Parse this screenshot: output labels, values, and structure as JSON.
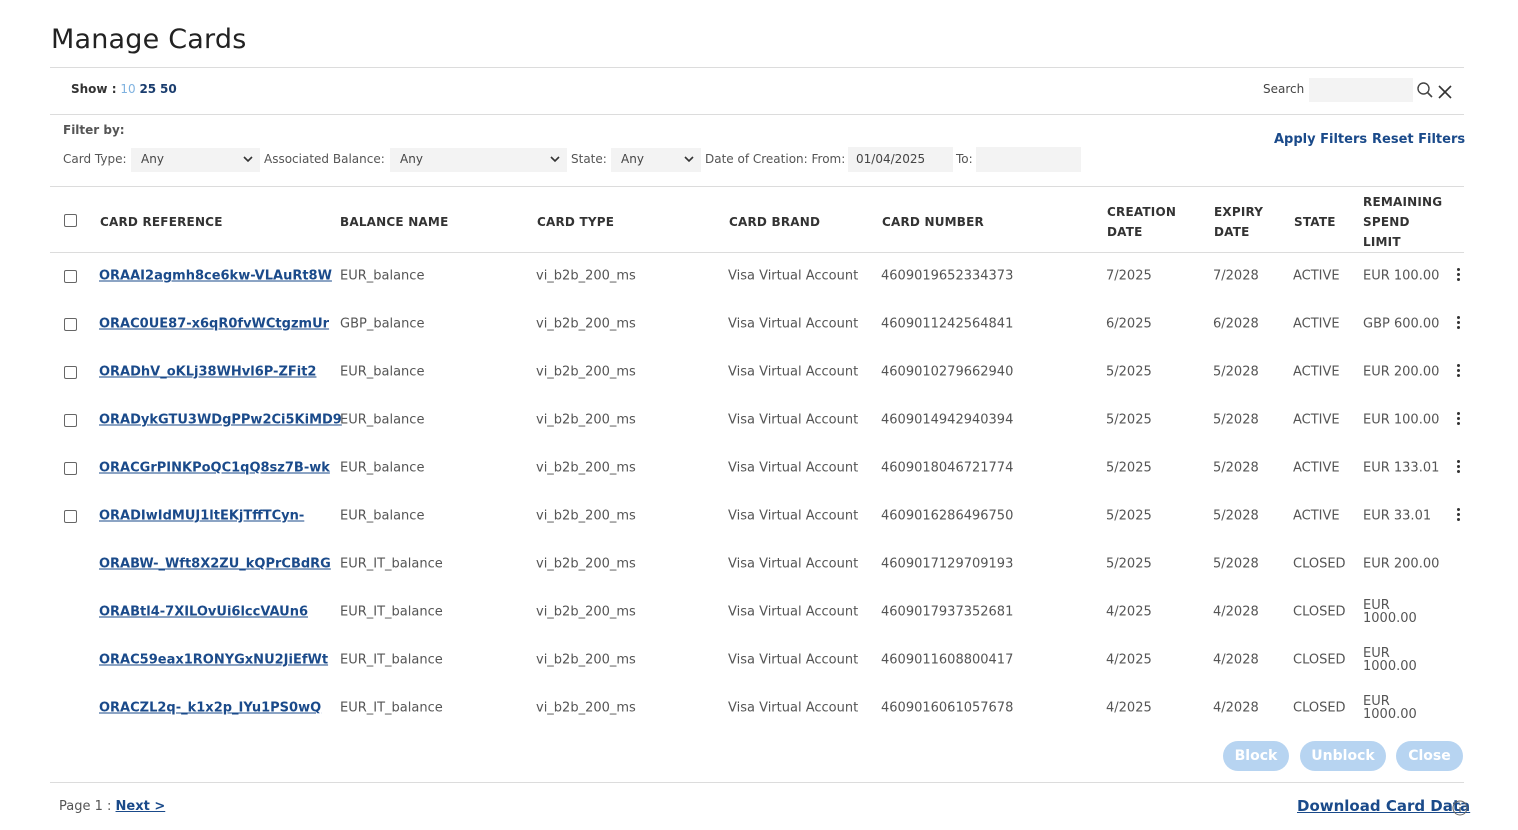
{
  "page": {
    "title": "Manage Cards"
  },
  "toolbar": {
    "show_label": "Show :",
    "page_sizes": [
      "10",
      "25",
      "50"
    ],
    "search_label": "Search",
    "search_value": ""
  },
  "filters": {
    "title": "Filter by:",
    "card_type_label": "Card Type:",
    "card_type_value": "Any",
    "assoc_balance_label": "Associated Balance:",
    "assoc_balance_value": "Any",
    "state_label": "State:",
    "state_value": "Any",
    "date_from_label": "Date of Creation: From:",
    "date_from_value": "01/04/2025",
    "date_to_label": "To:",
    "date_to_value": "",
    "apply_label": "Apply Filters",
    "reset_label": "Reset Filters"
  },
  "table": {
    "headers": {
      "card_reference": "CARD REFERENCE",
      "balance_name": "BALANCE NAME",
      "card_type": "CARD TYPE",
      "card_brand": "CARD BRAND",
      "card_number": "CARD NUMBER",
      "creation_line1": "CREATION",
      "creation_line2": "DATE",
      "expiry_line1": "EXPIRY",
      "expiry_line2": "DATE",
      "state": "STATE",
      "remaining_line1": "REMAINING",
      "remaining_line2": "SPEND",
      "remaining_line3": "LIMIT"
    },
    "rows": [
      {
        "ref": "ORAAI2agmh8ce6kw-VLAuRt8W",
        "balance": "EUR_balance",
        "type": "vi_b2b_200_ms",
        "brand": "Visa Virtual Account",
        "number": "4609019652334373",
        "created": "7/2025",
        "expiry": "7/2028",
        "state": "ACTIVE",
        "remaining": "EUR 100.00"
      },
      {
        "ref": "ORAC0UE87-x6qR0fvWCtgzmUr",
        "balance": "GBP_balance",
        "type": "vi_b2b_200_ms",
        "brand": "Visa Virtual Account",
        "number": "4609011242564841",
        "created": "6/2025",
        "expiry": "6/2028",
        "state": "ACTIVE",
        "remaining": "GBP 600.00"
      },
      {
        "ref": "ORADhV_oKLj38WHvl6P-ZFit2",
        "balance": "EUR_balance",
        "type": "vi_b2b_200_ms",
        "brand": "Visa Virtual Account",
        "number": "4609010279662940",
        "created": "5/2025",
        "expiry": "5/2028",
        "state": "ACTIVE",
        "remaining": "EUR 200.00"
      },
      {
        "ref": "ORADykGTU3WDgPPw2Ci5KiMD9",
        "balance": "EUR_balance",
        "type": "vi_b2b_200_ms",
        "brand": "Visa Virtual Account",
        "number": "4609014942940394",
        "created": "5/2025",
        "expiry": "5/2028",
        "state": "ACTIVE",
        "remaining": "EUR 100.00"
      },
      {
        "ref": "ORACGrPINKPoQC1qQ8sz7B-wk",
        "balance": "EUR_balance",
        "type": "vi_b2b_200_ms",
        "brand": "Visa Virtual Account",
        "number": "4609018046721774",
        "created": "5/2025",
        "expiry": "5/2028",
        "state": "ACTIVE",
        "remaining": "EUR 133.01"
      },
      {
        "ref": "ORADIwIdMUJ1ltEKjTffTCyn-",
        "balance": "EUR_balance",
        "type": "vi_b2b_200_ms",
        "brand": "Visa Virtual Account",
        "number": "4609016286496750",
        "created": "5/2025",
        "expiry": "5/2028",
        "state": "ACTIVE",
        "remaining": "EUR 33.01"
      },
      {
        "ref": "ORABW-_Wft8X2ZU_kQPrCBdRG",
        "balance": "EUR_IT_balance",
        "type": "vi_b2b_200_ms",
        "brand": "Visa Virtual Account",
        "number": "4609017129709193",
        "created": "5/2025",
        "expiry": "5/2028",
        "state": "CLOSED",
        "remaining": "EUR 200.00"
      },
      {
        "ref": "ORABtl4-7XILOvUi6lccVAUn6",
        "balance": "EUR_IT_balance",
        "type": "vi_b2b_200_ms",
        "brand": "Visa Virtual Account",
        "number": "4609017937352681",
        "created": "4/2025",
        "expiry": "4/2028",
        "state": "CLOSED",
        "remaining": "EUR 1000.00"
      },
      {
        "ref": "ORAC59eax1RONYGxNU2JiEfWt",
        "balance": "EUR_IT_balance",
        "type": "vi_b2b_200_ms",
        "brand": "Visa Virtual Account",
        "number": "4609011608800417",
        "created": "4/2025",
        "expiry": "4/2028",
        "state": "CLOSED",
        "remaining": "EUR 1000.00"
      },
      {
        "ref": "ORACZL2q-_k1x2p_IYu1PS0wQ",
        "balance": "EUR_IT_balance",
        "type": "vi_b2b_200_ms",
        "brand": "Visa Virtual Account",
        "number": "4609016061057678",
        "created": "4/2025",
        "expiry": "4/2028",
        "state": "CLOSED",
        "remaining": "EUR 1000.00"
      }
    ]
  },
  "actions": {
    "block_label": "Block",
    "unblock_label": "Unblock",
    "close_label": "Close"
  },
  "footer": {
    "page_label": "Page 1 :",
    "next_label": "Next >",
    "download_label": "Download Card Data"
  },
  "icons": {
    "search": "search-icon",
    "clear": "close-icon",
    "dropdown": "chevron-down-icon",
    "menu": "kebab-menu-icon",
    "info": "info-icon"
  },
  "colors": {
    "link": "#1a4a8a",
    "active_page": "#7fb2e0",
    "button_disabled": "#b7d4f1",
    "input_bg": "#f3f3f3"
  }
}
